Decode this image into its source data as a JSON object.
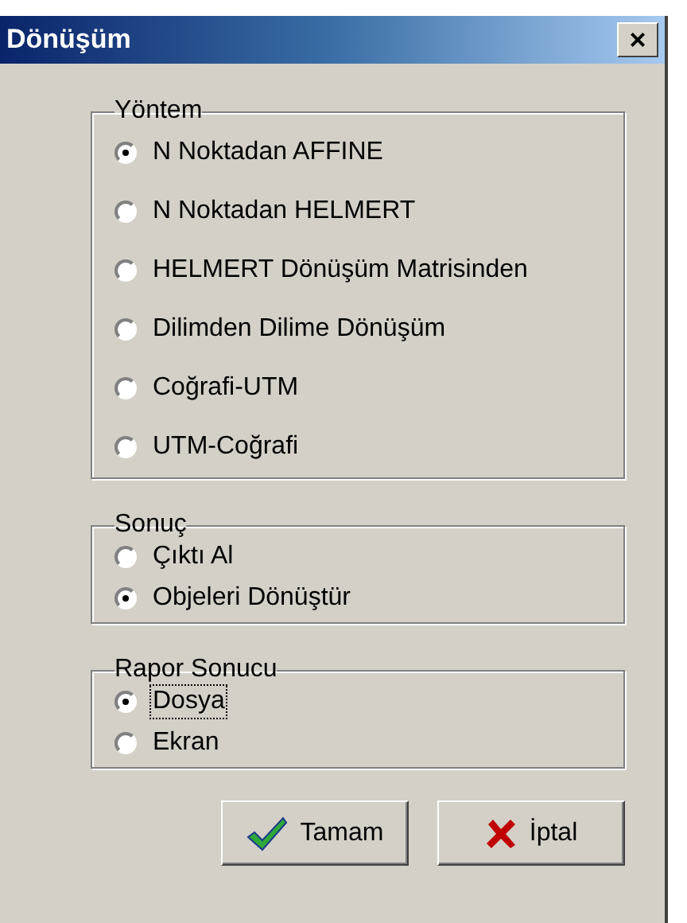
{
  "window": {
    "title": "Dönüşüm",
    "close": "×"
  },
  "groups": [
    {
      "title": "Yöntem",
      "options": [
        {
          "label": "N Noktadan AFFINE",
          "selected": true,
          "focused": false
        },
        {
          "label": "N Noktadan HELMERT",
          "selected": false,
          "focused": false
        },
        {
          "label": "HELMERT Dönüşüm Matrisinden",
          "selected": false,
          "focused": false
        },
        {
          "label": "Dilimden Dilime Dönüşüm",
          "selected": false,
          "focused": false
        },
        {
          "label": "Coğrafi-UTM",
          "selected": false,
          "focused": false
        },
        {
          "label": "UTM-Coğrafi",
          "selected": false,
          "focused": false
        }
      ]
    },
    {
      "title": "Sonuç",
      "options": [
        {
          "label": "Çıktı Al",
          "selected": false,
          "focused": false
        },
        {
          "label": "Objeleri Dönüştür",
          "selected": true,
          "focused": false
        }
      ]
    },
    {
      "title": "Rapor Sonucu",
      "options": [
        {
          "label": "Dosya",
          "selected": true,
          "focused": true
        },
        {
          "label": "Ekran",
          "selected": false,
          "focused": false
        }
      ]
    }
  ],
  "buttons": [
    {
      "label": "Tamam",
      "kind": "ok"
    },
    {
      "label": "İptal",
      "kind": "cancel"
    }
  ]
}
